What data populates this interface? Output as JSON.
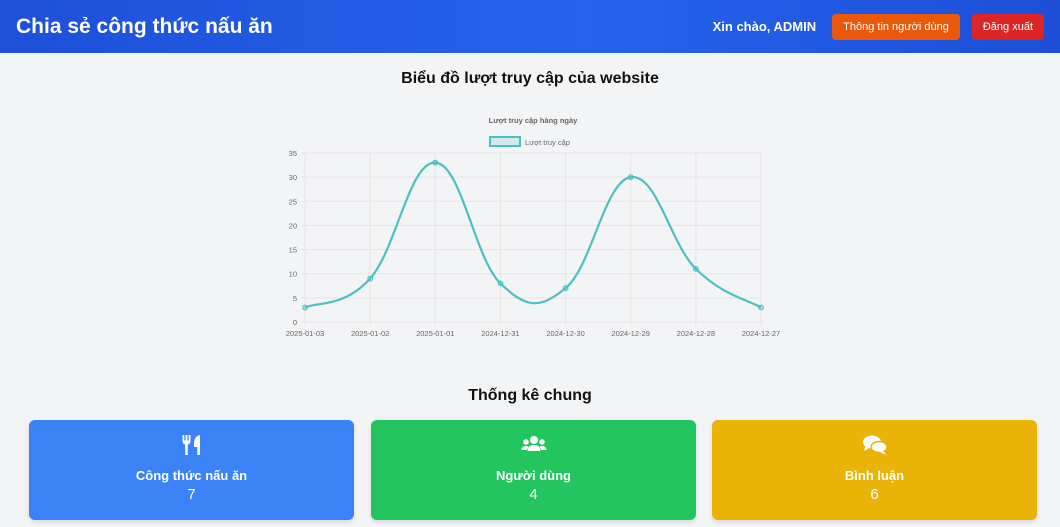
{
  "header": {
    "brand": "Chia sẻ công thức nấu ăn",
    "greeting": "Xin chào, ADMIN",
    "profile_button": "Thông tin người dùng",
    "logout_button": "Đăng xuất"
  },
  "chart_section": {
    "title": "Biểu đồ lượt truy cập của website"
  },
  "chart_data": {
    "type": "line",
    "title": "Lượt truy cập hàng ngày",
    "categories": [
      "2025-01-03",
      "2025-01-02",
      "2025-01-01",
      "2024-12-31",
      "2024-12-30",
      "2024-12-29",
      "2024-12-28",
      "2024-12-27"
    ],
    "series": [
      {
        "name": "Lượt truy cập",
        "values": [
          3,
          9,
          33,
          8,
          7,
          30,
          11,
          3
        ],
        "color": "#4bc0c0"
      }
    ],
    "yticks": [
      0,
      5,
      10,
      15,
      20,
      25,
      30,
      35
    ],
    "ylim": [
      0,
      35
    ],
    "grid": true,
    "legend": "top-center"
  },
  "stats": {
    "title": "Thống kê chung",
    "cards": [
      {
        "label": "Công thức nấu ăn",
        "value": "7",
        "icon": "utensils-icon",
        "color": "#3b82f6"
      },
      {
        "label": "Người dùng",
        "value": "4",
        "icon": "users-icon",
        "color": "#22c55e"
      },
      {
        "label": "Bình luận",
        "value": "6",
        "icon": "comments-icon",
        "color": "#eab308"
      }
    ]
  }
}
